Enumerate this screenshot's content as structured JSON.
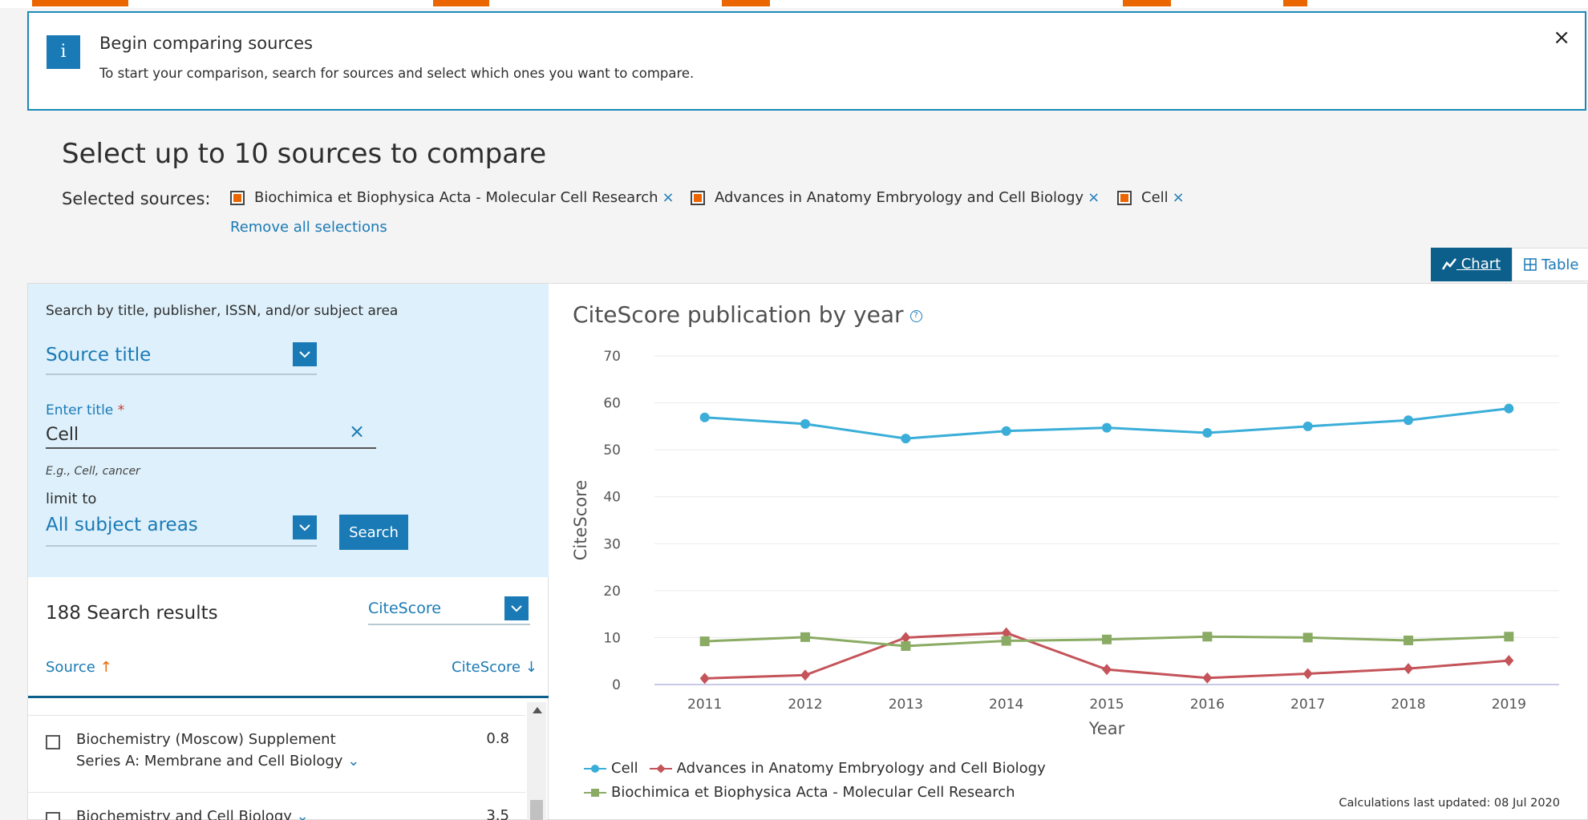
{
  "info": {
    "badge": "i",
    "title": "Begin comparing sources",
    "description": "To start your comparison, search for sources and select which ones you want to compare.",
    "close": "×"
  },
  "page_title": "Select up to 10 sources to compare",
  "selected": {
    "label": "Selected sources:",
    "chips": [
      "Biochimica et Biophysica Acta - Molecular Cell Research",
      "Advances in Anatomy Embryology and Cell Biology",
      "Cell"
    ],
    "remove_symbol": "×",
    "remove_all": "Remove all selections"
  },
  "view_toggle": {
    "chart": "Chart",
    "table": "Table",
    "active": "chart"
  },
  "search": {
    "hint": "Search by title, publisher, ISSN, and/or subject area",
    "type_select": "Source title",
    "enter_label": "Enter title",
    "required_mark": "*",
    "title_value": "Cell",
    "clear": "×",
    "example": "E.g., Cell, cancer",
    "limit_label": "limit to",
    "subject_select": "All subject areas",
    "search_button": "Search"
  },
  "results": {
    "count_label": "188 Search results",
    "sort_select": "CiteScore",
    "col_source": "Source",
    "col_citescore": "CiteScore",
    "rows": [
      {
        "line1": "Biochemistry (Moscow) Supplement",
        "line2": "Series A: Membrane and Cell Biology",
        "score": "0.8"
      },
      {
        "line1": "Biochemistry and Cell Biology",
        "line2": "",
        "score": "3.5"
      }
    ]
  },
  "chart_title": "CiteScore publication by year",
  "calc_note": "Calculations last updated: 08 Jul 2020",
  "colors": {
    "cell": "#3aaed8",
    "advances": "#c4545a",
    "biochimica": "#8aab63",
    "accent": "#1a7ab6",
    "orange": "#eb6500"
  },
  "chart_data": {
    "type": "line",
    "title": "CiteScore publication by year",
    "xlabel": "Year",
    "ylabel": "CiteScore",
    "x": [
      "2011",
      "2012",
      "2013",
      "2014",
      "2015",
      "2016",
      "2017",
      "2018",
      "2019"
    ],
    "ylim": [
      0,
      70
    ],
    "yticks": [
      0,
      10,
      20,
      30,
      40,
      50,
      60,
      70
    ],
    "grid": true,
    "legend_position": "bottom-left",
    "series": [
      {
        "name": "Cell",
        "marker": "circle",
        "values": [
          56.9,
          55.5,
          52.4,
          54.0,
          54.7,
          53.6,
          55.0,
          56.3,
          58.8
        ]
      },
      {
        "name": "Advances in Anatomy Embryology and Cell Biology",
        "marker": "diamond",
        "values": [
          1.3,
          2.0,
          10.0,
          11.0,
          3.2,
          1.4,
          2.3,
          3.4,
          5.1
        ]
      },
      {
        "name": "Biochimica et Biophysica Acta - Molecular Cell Research",
        "marker": "square",
        "values": [
          9.2,
          10.1,
          8.2,
          9.3,
          9.6,
          10.2,
          10.0,
          9.4,
          10.2
        ]
      }
    ]
  }
}
